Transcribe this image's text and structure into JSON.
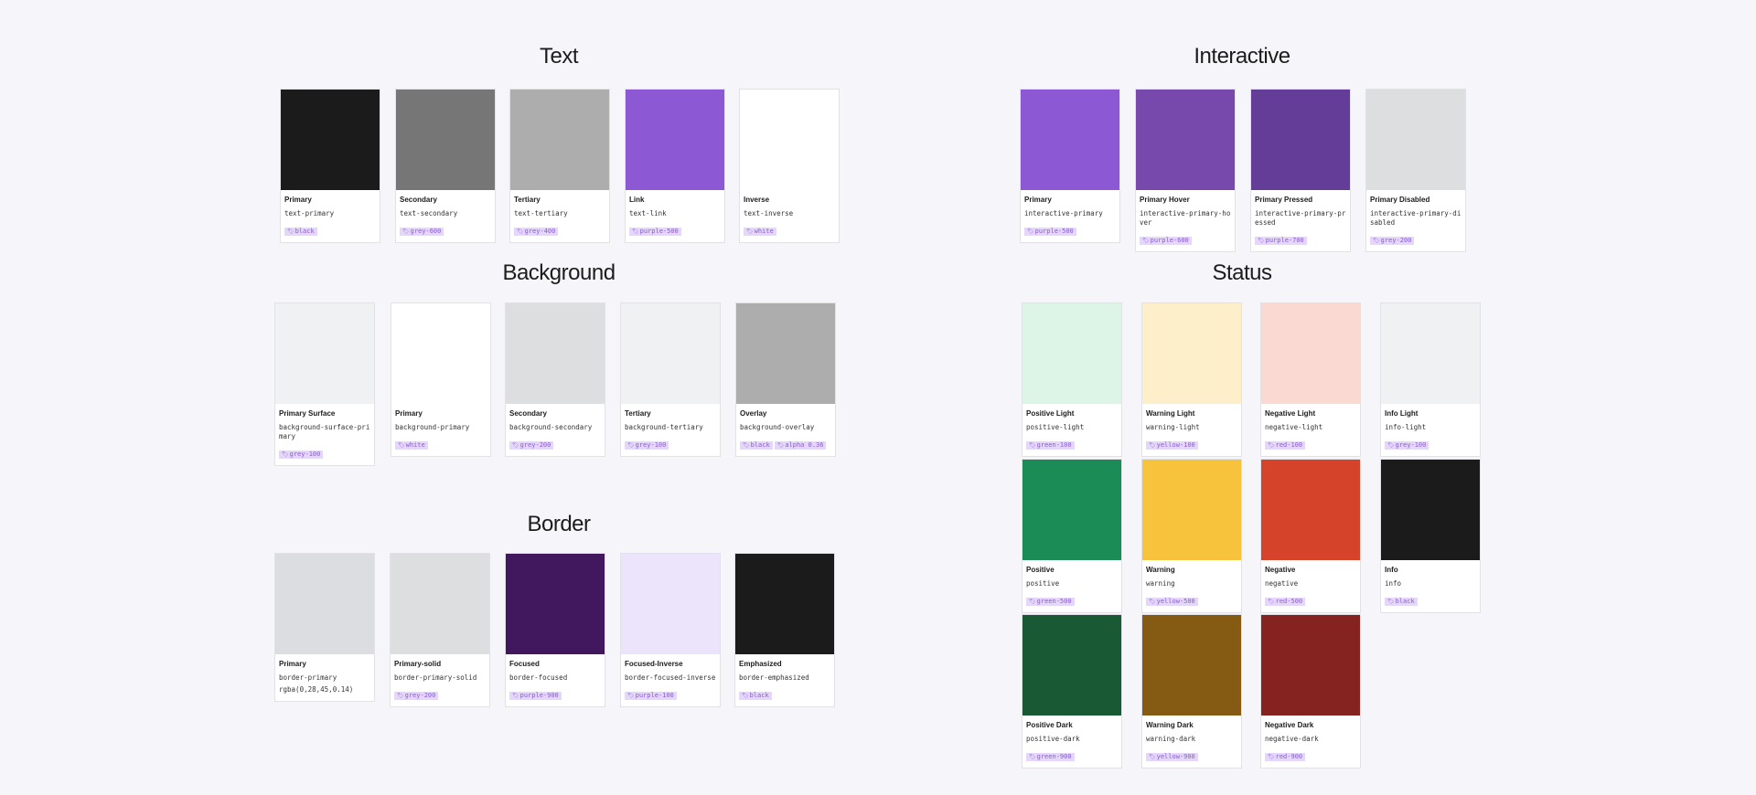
{
  "sections": {
    "text": {
      "title": "Text",
      "cards": [
        {
          "label": "Primary",
          "token": "text-primary",
          "chips": [
            "black"
          ],
          "color": "#1b1b1b"
        },
        {
          "label": "Secondary",
          "token": "text-secondary",
          "chips": [
            "grey-600"
          ],
          "color": "#767676"
        },
        {
          "label": "Tertiary",
          "token": "text-tertiary",
          "chips": [
            "grey-400"
          ],
          "color": "#adadad"
        },
        {
          "label": "Link",
          "token": "text-link",
          "chips": [
            "purple-500"
          ],
          "color": "#8c58d3"
        },
        {
          "label": "Inverse",
          "token": "text-inverse",
          "chips": [
            "white"
          ],
          "color": "#ffffff"
        }
      ]
    },
    "interactive": {
      "title": "Interactive",
      "cards": [
        {
          "label": "Primary",
          "token": "interactive-primary",
          "chips": [
            "purple-500"
          ],
          "color": "#8c58d3"
        },
        {
          "label": "Primary Hover",
          "token": "interactive-primary-hover",
          "chips": [
            "purple-600"
          ],
          "color": "#7849ad"
        },
        {
          "label": "Primary Pressed",
          "token": "interactive-primary-pressed",
          "chips": [
            "purple-700"
          ],
          "color": "#643d99"
        },
        {
          "label": "Primary Disabled",
          "token": "interactive-primary-disabled",
          "chips": [
            "grey-200"
          ],
          "color": "#dddee0"
        }
      ]
    },
    "background": {
      "title": "Background",
      "cards": [
        {
          "label": "Primary Surface",
          "token": "background-surface-primary",
          "chips": [
            "grey-100"
          ],
          "color": "#eff1f3"
        },
        {
          "label": "Primary",
          "token": "background-primary",
          "chips": [
            "white"
          ],
          "color": "#ffffff"
        },
        {
          "label": "Secondary",
          "token": "background-secondary",
          "chips": [
            "grey-200"
          ],
          "color": "#dddee0"
        },
        {
          "label": "Tertiary",
          "token": "background-tertiary",
          "chips": [
            "grey-100"
          ],
          "color": "#eff1f3"
        },
        {
          "label": "Overlay",
          "token": "background-overlay",
          "chips": [
            "black",
            "alpha 0.36"
          ],
          "color": "#adadad"
        }
      ]
    },
    "status": {
      "title": "Status",
      "cards": [
        {
          "label": "Positive Light",
          "token": "positive-light",
          "chips": [
            "green-100"
          ],
          "color": "#dcf5e7"
        },
        {
          "label": "Warning Light",
          "token": "warning-light",
          "chips": [
            "yellow-100"
          ],
          "color": "#feefcb"
        },
        {
          "label": "Negative Light",
          "token": "negative-light",
          "chips": [
            "red-100"
          ],
          "color": "#fad9d3"
        },
        {
          "label": "Info Light",
          "token": "info-light",
          "chips": [
            "grey-100"
          ],
          "color": "#eff1f3"
        },
        {
          "label": "Positive",
          "token": "positive",
          "chips": [
            "green-500"
          ],
          "color": "#1c8c57"
        },
        {
          "label": "Warning",
          "token": "warning",
          "chips": [
            "yellow-500"
          ],
          "color": "#f8c33c"
        },
        {
          "label": "Negative",
          "token": "negative",
          "chips": [
            "red-500"
          ],
          "color": "#d4432a"
        },
        {
          "label": "Info",
          "token": "info",
          "chips": [
            "black"
          ],
          "color": "#1b1b1b"
        },
        {
          "label": "Positive Dark",
          "token": "positive-dark",
          "chips": [
            "green-900"
          ],
          "color": "#195a35"
        },
        {
          "label": "Warning Dark",
          "token": "warning-dark",
          "chips": [
            "yellow-900"
          ],
          "color": "#855b14"
        },
        {
          "label": "Negative Dark",
          "token": "negative-dark",
          "chips": [
            "red-900"
          ],
          "color": "#842320"
        }
      ]
    },
    "border": {
      "title": "Border",
      "cards": [
        {
          "label": "Primary",
          "token": "border-primary",
          "extra": "rgba(0,28,45,0.14)",
          "chips": [],
          "color": "#dbdde0"
        },
        {
          "label": "Primary-solid",
          "token": "border-primary-solid",
          "chips": [
            "grey-200"
          ],
          "color": "#dddee0"
        },
        {
          "label": "Focused",
          "token": "border-focused",
          "chips": [
            "purple-900"
          ],
          "color": "#41175e"
        },
        {
          "label": "Focused-Inverse",
          "token": "border-focused-inverse",
          "chips": [
            "purple-100"
          ],
          "color": "#ebe4fb"
        },
        {
          "label": "Emphasized",
          "token": "border-emphasized",
          "chips": [
            "black"
          ],
          "color": "#1b1b1b"
        }
      ]
    }
  },
  "icons": {
    "chip": "tag-icon"
  }
}
